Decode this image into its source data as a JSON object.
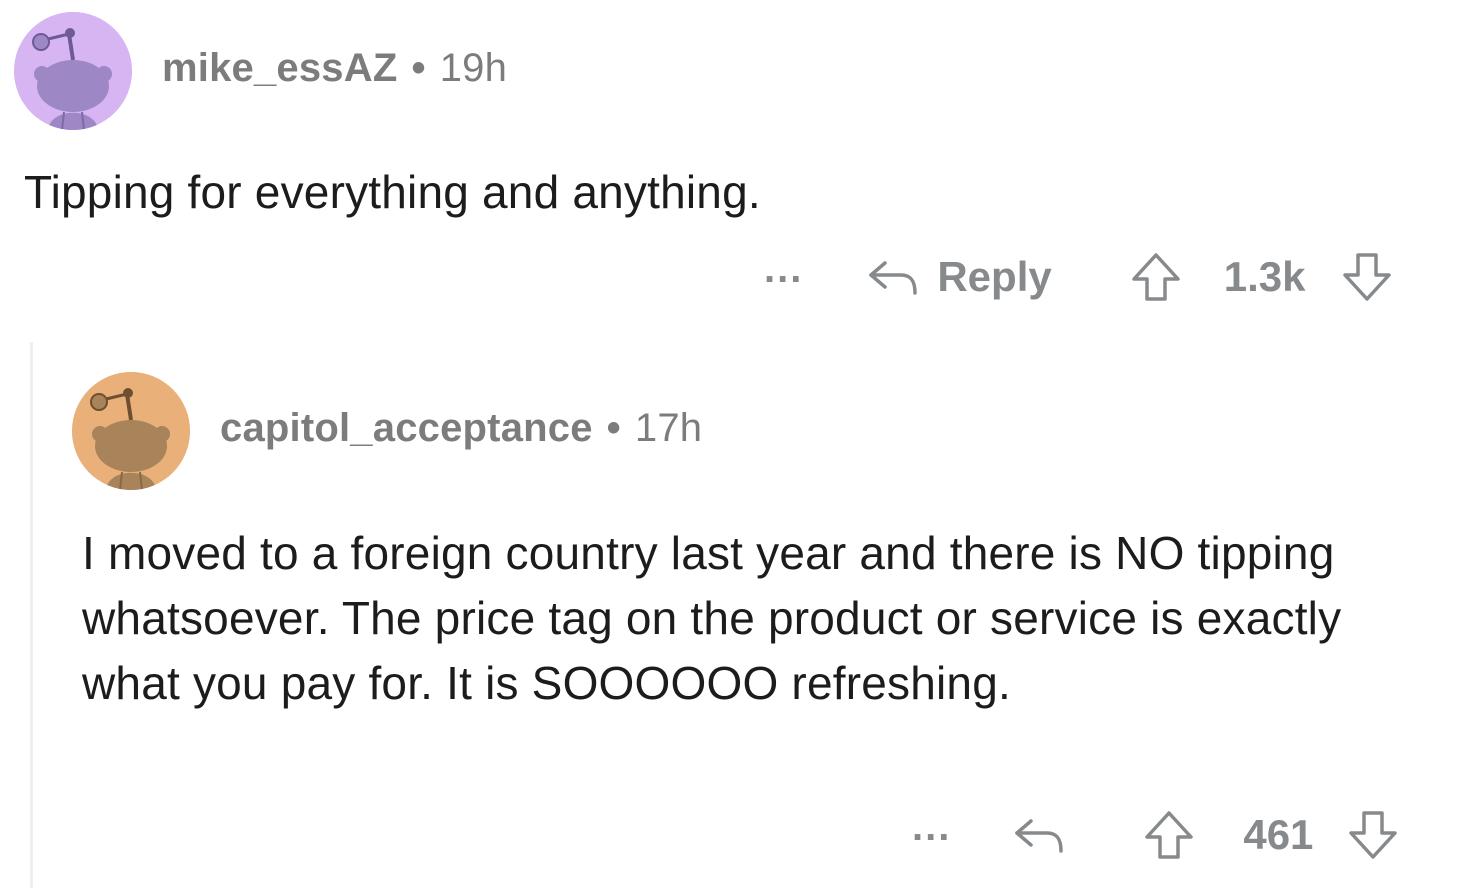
{
  "comments": [
    {
      "username": "mike_essAZ",
      "separator": "•",
      "time": "19h",
      "text": "Tipping for everything and anything.",
      "more_label": "...",
      "reply_label": "Reply",
      "votes": "1.3k",
      "avatar_color": "#d7b5f2",
      "snoo_color": "#9d87c4"
    },
    {
      "username": "capitol_acceptance",
      "separator": "•",
      "time": "17h",
      "text": "I moved to a foreign country last year and there is NO tipping whatsoever. The price tag on the product or service is exactly what you pay for. It is SOOOOOO refreshing.",
      "more_label": "...",
      "votes": "461",
      "avatar_color": "#e9b079",
      "snoo_color": "#a9835a"
    }
  ],
  "colors": {
    "meta": "#7c7c7c",
    "body": "#1c1c1c",
    "action": "#878a8c",
    "thread_line": "#edeff1"
  }
}
